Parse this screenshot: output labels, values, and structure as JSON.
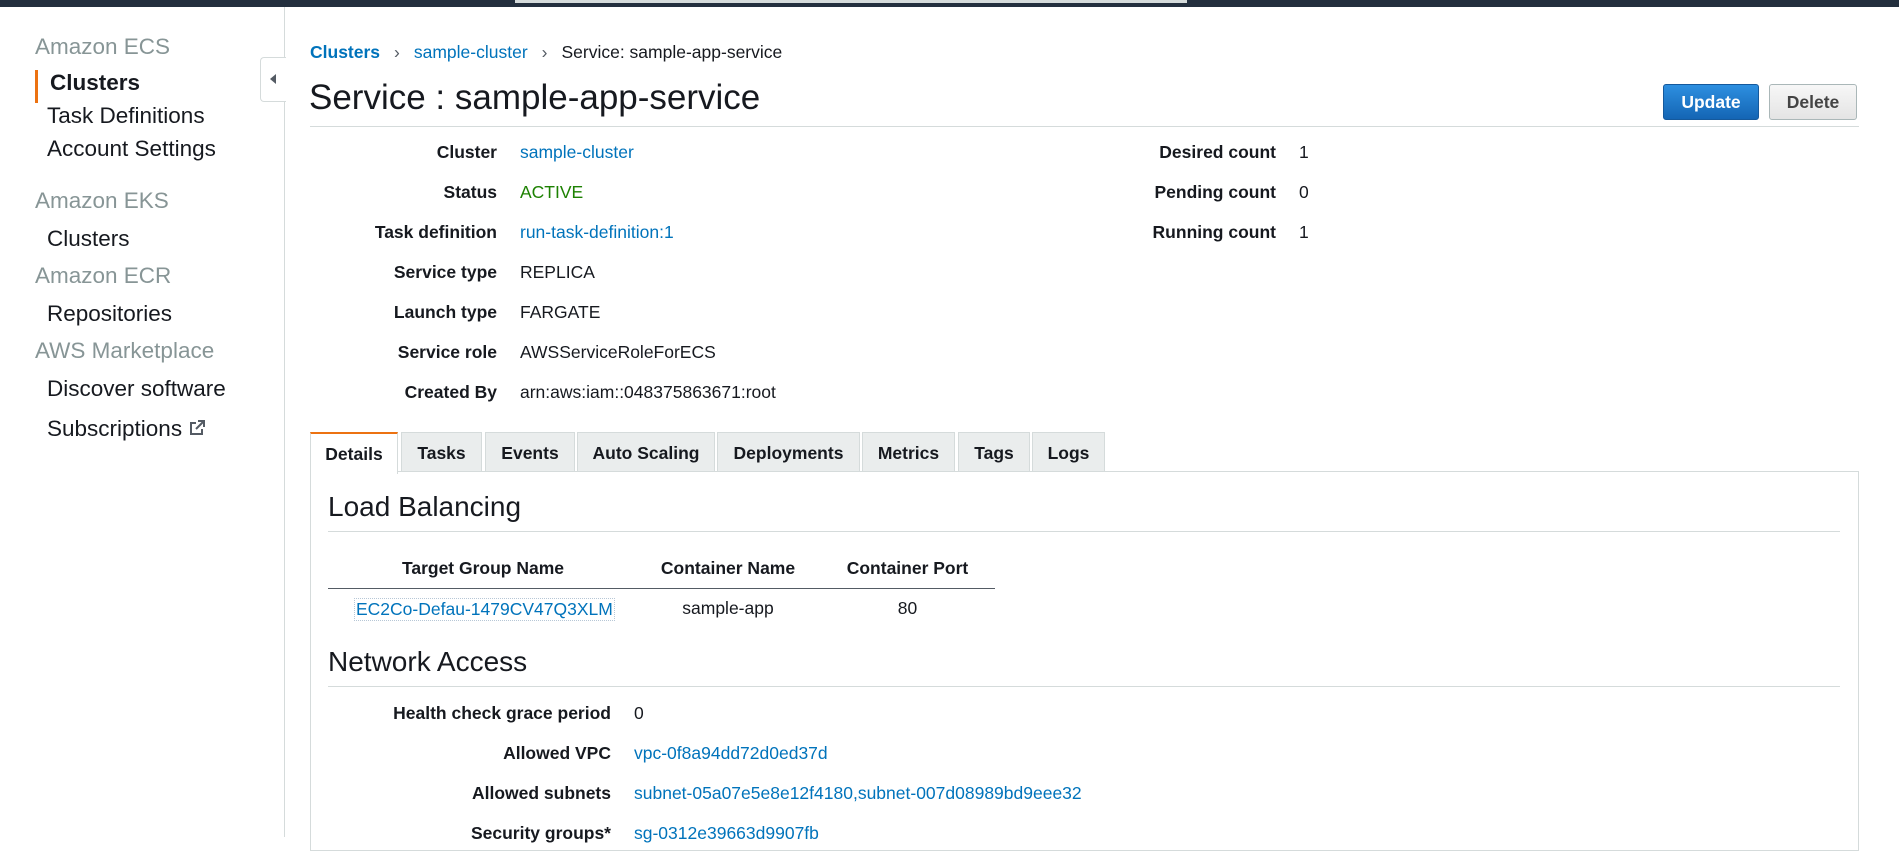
{
  "sidebar": {
    "sections": [
      {
        "title": "Amazon ECS",
        "items": [
          "Clusters",
          "Task Definitions",
          "Account Settings"
        ]
      },
      {
        "title": "Amazon EKS",
        "items": [
          "Clusters"
        ]
      },
      {
        "title": "Amazon ECR",
        "items": [
          "Repositories"
        ]
      },
      {
        "title": "AWS Marketplace",
        "items": [
          "Discover software",
          "Subscriptions"
        ]
      }
    ],
    "active_item": "Clusters",
    "collapse_icon": "caret-left-icon",
    "external_link_icon": "external-link-icon"
  },
  "breadcrumb": {
    "items": [
      "Clusters",
      "sample-cluster",
      "Service: sample-app-service"
    ],
    "separator": "›"
  },
  "header": {
    "title": "Service : sample-app-service",
    "update_label": "Update",
    "delete_label": "Delete"
  },
  "service_details": {
    "left": [
      {
        "label": "Cluster",
        "value": "sample-cluster"
      },
      {
        "label": "Status",
        "value": "ACTIVE"
      },
      {
        "label": "Task definition",
        "value": "run-task-definition:1"
      },
      {
        "label": "Service type",
        "value": "REPLICA"
      },
      {
        "label": "Launch type",
        "value": "FARGATE"
      },
      {
        "label": "Service role",
        "value": "AWSServiceRoleForECS"
      },
      {
        "label": "Created By",
        "value": "arn:aws:iam::048375863671:root"
      }
    ],
    "right": [
      {
        "label": "Desired count",
        "value": "1"
      },
      {
        "label": "Pending count",
        "value": "0"
      },
      {
        "label": "Running count",
        "value": "1"
      }
    ]
  },
  "tabs": [
    "Details",
    "Tasks",
    "Events",
    "Auto Scaling",
    "Deployments",
    "Metrics",
    "Tags",
    "Logs"
  ],
  "active_tab": "Details",
  "load_balancing": {
    "title": "Load Balancing",
    "columns": [
      "Target Group Name",
      "Container Name",
      "Container Port"
    ],
    "rows": [
      [
        "EC2Co-Defau-1479CV47Q3XLM",
        "sample-app",
        "80"
      ]
    ]
  },
  "network_access": {
    "title": "Network Access",
    "fields": [
      {
        "label": "Health check grace period",
        "value": "0"
      },
      {
        "label": "Allowed VPC",
        "value": "vpc-0f8a94dd72d0ed37d"
      },
      {
        "label": "Allowed subnets",
        "value": "subnet-05a07e5e8e12f4180,subnet-007d08989bd9eee32"
      },
      {
        "label": "Security groups*",
        "value": "sg-0312e39663d9907fb"
      }
    ]
  },
  "colors": {
    "link": "#0073bb",
    "active_green": "#1d8102",
    "accent_orange": "#ec7211",
    "primary_button": "#1b7ed4",
    "topbar": "#232f3e"
  }
}
